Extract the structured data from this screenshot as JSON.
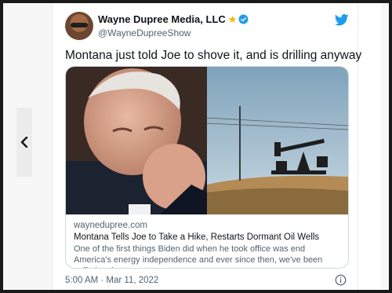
{
  "tweet": {
    "author_name": "Wayne Dupree Media, LLC",
    "author_badge": "★",
    "handle": "@WayneDupreeShow",
    "text": "Montana just told Joe to shove it, and is drilling anyway",
    "timestamp": "5:00 AM · Mar 11, 2022"
  },
  "card": {
    "domain": "waynedupree.com",
    "title": "Montana Tells Joe to Take a Hike, Restarts Dormant Oil Wells",
    "description": "One of the first things Biden did when he took office was end America's energy independence and ever since then, we've been suffering the ..."
  },
  "icons": {
    "back": "chevron-left-icon",
    "verified": "verified-badge-icon",
    "logo": "twitter-bird-icon",
    "info": "info-icon"
  },
  "colors": {
    "twitter_blue": "#1d9bf0",
    "gold_star": "#f4b400",
    "muted_text": "#536471"
  }
}
